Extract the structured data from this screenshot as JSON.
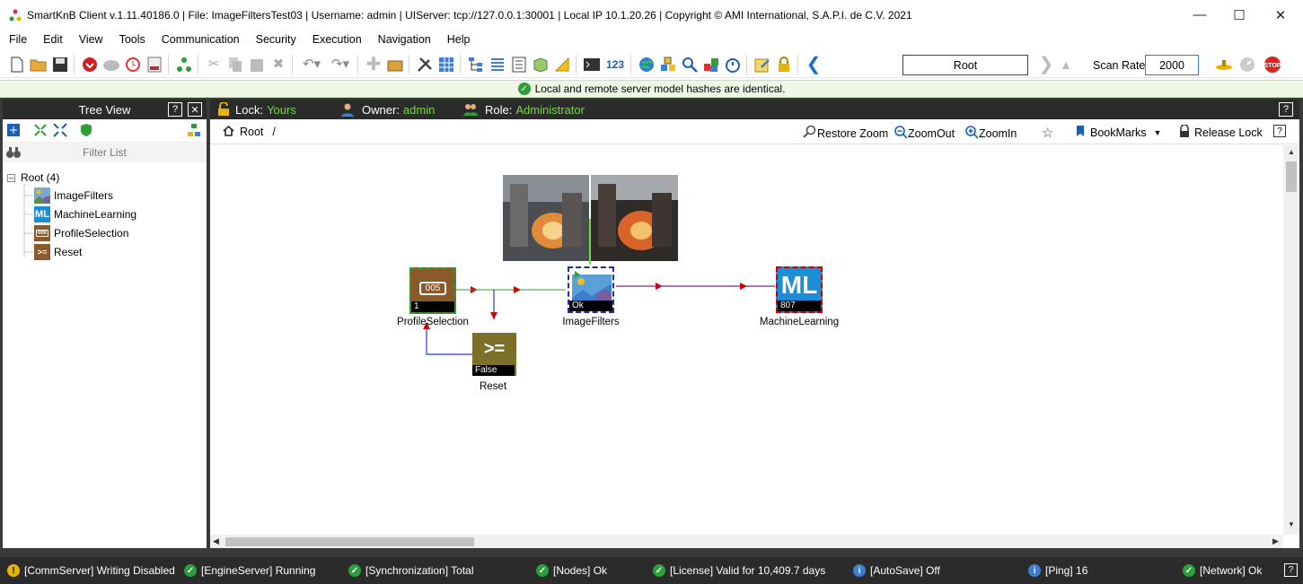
{
  "window": {
    "title": "SmartKnB Client v.1.11.40186.0  |  File: ImageFiltersTest03  |  Username: admin  |  UIServer: tcp://127.0.0.1:30001  |  Local IP 10.1.20.26  |  Copyright ©  AMI International, S.A.P.I. de C.V. 2021"
  },
  "menu": [
    "File",
    "Edit",
    "View",
    "Tools",
    "Communication",
    "Security",
    "Execution",
    "Navigation",
    "Help"
  ],
  "toolbar": {
    "location": "Root",
    "scan_rate_label": "Scan Rate:",
    "scan_rate_value": "2000"
  },
  "notice": "Local and remote server model hashes are identical.",
  "tree": {
    "title": "Tree View",
    "filter_placeholder": "Filter List",
    "root_label": "Root  (4)",
    "items": [
      {
        "label": "ImageFilters",
        "icon": "image-filter-icon"
      },
      {
        "label": "MachineLearning",
        "icon": "ml-icon"
      },
      {
        "label": "ProfileSelection",
        "icon": "profile-icon"
      },
      {
        "label": "Reset",
        "icon": "compare-icon"
      }
    ]
  },
  "workspace": {
    "lock_label": "Lock:",
    "lock_value": "Yours",
    "owner_label": "Owner:",
    "owner_value": "admin",
    "role_label": "Role:",
    "role_value": "Administrator",
    "breadcrumb": "Root",
    "breadcrumb_sep": "/",
    "restore_zoom": "Restore Zoom",
    "zoom_out": "ZoomOut",
    "zoom_in": "ZoomIn",
    "bookmarks": "BookMarks",
    "release_lock": "Release Lock"
  },
  "nodes": [
    {
      "id": "profile",
      "label": "ProfileSelection",
      "value": "1",
      "icon_text": "005"
    },
    {
      "id": "imagefilters",
      "label": "ImageFilters",
      "value": "Ok"
    },
    {
      "id": "ml",
      "label": "MachineLearning",
      "value": "807",
      "icon_text": "ML"
    },
    {
      "id": "reset",
      "label": "Reset",
      "value": "False",
      "icon_text": ">="
    }
  ],
  "status": [
    {
      "text": "[CommServer] Writing Disabled",
      "kind": "warn"
    },
    {
      "text": "[EngineServer] Running",
      "kind": "ok"
    },
    {
      "text": "[Synchronization] Total",
      "kind": "ok"
    },
    {
      "text": "[Nodes] Ok",
      "kind": "ok"
    },
    {
      "text": "[License] Valid for 10,409.7 days",
      "kind": "ok"
    },
    {
      "text": "[AutoSave] Off",
      "kind": "info"
    },
    {
      "text": "[Ping] 16",
      "kind": "info"
    },
    {
      "text": "[Network] Ok",
      "kind": "ok"
    }
  ],
  "colors": {
    "ok": "#2e9e3a",
    "warn": "#e8b400",
    "info": "#3c7fd1",
    "panel_header": "#2b2b2b",
    "accent_green": "#7bd44a",
    "profile_node": "#8b5a2b",
    "ml_node": "#1a8fd8",
    "reset_node": "#7c6f2a"
  }
}
